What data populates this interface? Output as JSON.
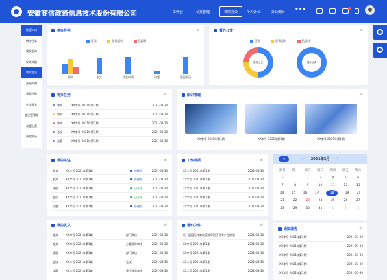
{
  "app": {
    "title": "安徽商信政通信息技术股份有限公司"
  },
  "nav": [
    {
      "label": "工作台"
    },
    {
      "label": "公文管理"
    },
    {
      "label": "日常办公"
    },
    {
      "label": "个人办公"
    },
    {
      "label": "办公统计"
    }
  ],
  "nav_more": "•••",
  "sidebar": {
    "items": [
      {
        "label": "快捷入口"
      },
      {
        "label": "待办任务"
      },
      {
        "label": "我发起的"
      },
      {
        "label": "发文拟稿"
      },
      {
        "label": "收文登记"
      },
      {
        "label": "签报拟稿"
      },
      {
        "label": "领导活动"
      },
      {
        "label": "会议报名"
      },
      {
        "label": "会议室预定"
      },
      {
        "label": "议题上报"
      },
      {
        "label": "请假申请"
      }
    ]
  },
  "colors": {
    "primary": "#1f54d6",
    "blue": "#3b86f2",
    "yellow": "#f6c738",
    "red": "#f26c6c"
  },
  "todo_chart": {
    "title": "待办任务",
    "legend": [
      "正常",
      "即将超时",
      "已超时"
    ]
  },
  "chart_data": [
    {
      "type": "bar",
      "title": "待办任务",
      "categories": [
        "收文",
        "发文",
        "信息申请",
        "议题",
        "签报申请"
      ],
      "series": [
        {
          "name": "正常",
          "values": [
            12,
            18,
            20,
            3,
            20
          ]
        },
        {
          "name": "即将超时",
          "values": [
            17,
            0,
            0,
            0,
            0
          ]
        },
        {
          "name": "已超时",
          "values": [
            9,
            0,
            0,
            0,
            0
          ]
        }
      ],
      "ylim": [
        0,
        30
      ]
    },
    {
      "type": "pie",
      "title": "督办公文",
      "series": [
        {
          "name": "督办公文",
          "values": [
            {
              "label": "正常",
              "value": 50
            },
            {
              "label": "即将超时",
              "value": 25
            },
            {
              "label": "已超时",
              "value": 25
            }
          ]
        },
        {
          "name": "督办公文",
          "values": [
            {
              "label": "正常",
              "value": 100
            }
          ]
        }
      ]
    }
  ],
  "supervise_chart": {
    "title": "督办公文",
    "legend": [
      "正常",
      "即将超时",
      "已超时"
    ],
    "center_label": "督办公文"
  },
  "todo_list": {
    "title": "待办任务",
    "rows": [
      {
        "type": "收文",
        "title": "XX字号 2021年第1期",
        "date": "2021-03-30",
        "color": "#3b86f2"
      },
      {
        "type": "收文",
        "title": "XX字号 2021年第1期",
        "date": "2021-03-30",
        "color": "#f6c738"
      },
      {
        "type": "收文",
        "title": "XX字号 2021年第1期",
        "date": "2021-03-30",
        "color": "#f26c6c"
      },
      {
        "type": "会议",
        "title": "XX字号 2021年第1期",
        "date": "2021-03-30",
        "color": "#3b86f2"
      },
      {
        "type": "议题",
        "title": "XX字号 2021年第1期",
        "date": "2021-03-30",
        "color": "#3b86f2"
      }
    ]
  },
  "news": {
    "title": "知识管理",
    "items": [
      {
        "caption": "XX字号 2021年第1期"
      },
      {
        "caption": "XX字号 2021年第1期"
      },
      {
        "caption": "XX字号 2021年第1期"
      }
    ]
  },
  "focus": {
    "title": "我的关注",
    "rows": [
      {
        "type": "收文",
        "title": "XX字号 2021年第1期",
        "status": "办理中",
        "date": "2021-03-30",
        "color": "#1f54d6"
      },
      {
        "type": "发文",
        "title": "XX字号 2021年第1期",
        "status": "办理中",
        "date": "2021-03-30",
        "color": "#1f54d6"
      },
      {
        "type": "请假",
        "title": "XX字号 2021年第1期",
        "status": "已办结",
        "date": "2021-03-30",
        "color": "#2bb673"
      },
      {
        "type": "会议",
        "title": "XX字号 2021年第1期",
        "status": "已办结",
        "date": "2021-03-30",
        "color": "#2bb673"
      },
      {
        "type": "议题",
        "title": "XX字号 2021年第1期",
        "status": "办理中",
        "date": "2021-03-30",
        "color": "#1f54d6"
      }
    ]
  },
  "weekly": {
    "title": "工作简报",
    "rows": [
      {
        "title": "XX字号 2021年第1期",
        "date": "2021-03-30"
      },
      {
        "title": "XX字号 2021年第1期",
        "date": "2021-03-30"
      },
      {
        "title": "XX字号 2021年第1期",
        "date": "2021-03-30"
      },
      {
        "title": "XX字号 2021年第1期",
        "date": "2021-03-30"
      },
      {
        "title": "XX字号 2021年第1期",
        "date": "2021-03-30"
      }
    ]
  },
  "calendar": {
    "today_btn": "今",
    "month": "2021年3月",
    "weekdays": [
      "周日",
      "周一",
      "周二",
      "周三",
      "周四",
      "周五",
      "周六"
    ],
    "weeks": [
      [
        "28",
        "1",
        "2",
        "3",
        "4",
        "5",
        "6"
      ],
      [
        "7",
        "8",
        "9",
        "10",
        "11",
        "12",
        "13"
      ],
      [
        "14",
        "15",
        "16",
        "17",
        "18",
        "19",
        "20"
      ],
      [
        "21",
        "22",
        "23",
        "24",
        "25",
        "26",
        "27"
      ],
      [
        "28",
        "29",
        "30",
        "31",
        "1",
        "2",
        "3"
      ]
    ]
  },
  "mydocs": {
    "title": "我的发文",
    "rows": [
      {
        "type": "收文",
        "title": "XX字号 2021年第1期",
        "dept": "部门审核",
        "date": "2021-03-30"
      },
      {
        "type": "发文",
        "title": "XX字号 2021年第1期",
        "dept": "分管领导审核",
        "date": "2021-03-30"
      },
      {
        "type": "请假",
        "title": "XX字号 2021年第1期",
        "dept": "部门审核",
        "date": "2021-03-30"
      },
      {
        "type": "会议",
        "title": "XX字号 2021年第1期",
        "dept": "会议",
        "date": "2021-03-30"
      },
      {
        "type": "议题",
        "title": "XX字号 2021年第1期",
        "dept": "单位领导审核",
        "date": "2021-03-30"
      }
    ]
  },
  "files": {
    "title": "通知文件",
    "rows": [
      {
        "title": "新一届国际作商发现领导班子选举产生新思",
        "date": "2021-03-30"
      },
      {
        "title": "XX字号 2021年第1期",
        "date": "2021-03-30"
      },
      {
        "title": "XX字号 2021年第1期",
        "date": "2021-03-30"
      },
      {
        "title": "XX字号 2021年第1期",
        "date": "2021-03-30"
      },
      {
        "title": "XX字号 2021年第1期",
        "date": "2021-03-30"
      }
    ]
  },
  "notices": {
    "title": "通知通告",
    "rows": [
      {
        "title": "XX字号 2021年第1期",
        "date": "2021-03-30"
      },
      {
        "title": "XX字号 2021年第1期",
        "date": "2021-03-30"
      },
      {
        "title": "XX字号 2021年第1期",
        "date": "2021-03-30"
      },
      {
        "title": "XX字号 2021年第1期",
        "date": "2021-03-30"
      },
      {
        "title": "XX字号 2021年第1期",
        "date": "2021-03-30"
      }
    ]
  }
}
